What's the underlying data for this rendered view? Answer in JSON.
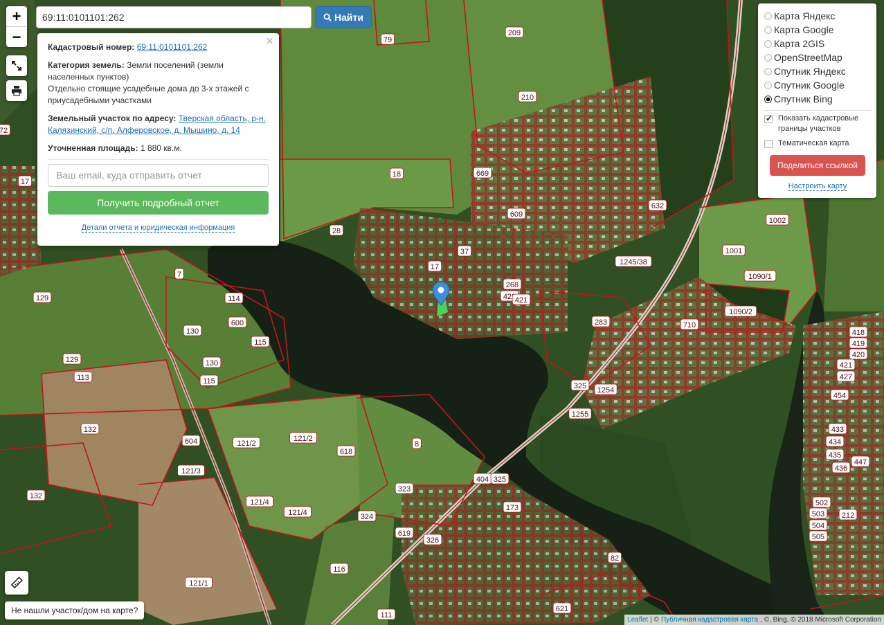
{
  "map": {
    "parcel_labels": [
      "209",
      "210",
      "79",
      "18",
      "28",
      "669",
      "609",
      "37",
      "17",
      "632",
      "1245/38",
      "268",
      "422",
      "421",
      "283",
      "1002",
      "1001",
      "1090/1",
      "1090/2",
      "710",
      "418",
      "419",
      "420",
      "421",
      "427",
      "454",
      "433",
      "434",
      "435",
      "436",
      "447",
      "502",
      "503",
      "504",
      "505",
      "212",
      "325",
      "1254",
      "1255",
      "404",
      "325",
      "7",
      "129",
      "114",
      "600",
      "130",
      "115",
      "130",
      "115",
      "129",
      "113",
      "132",
      "604",
      "121/3",
      "121/2",
      "121/2",
      "618",
      "8",
      "323",
      "324",
      "121/4",
      "121/4",
      "619",
      "326",
      "173",
      "116",
      "132",
      "121/1",
      "111",
      "621",
      "82",
      "72",
      "17"
    ],
    "icons": [
      "location-marker-icon"
    ]
  },
  "controls": {
    "zoom_in": "+",
    "zoom_out": "−"
  },
  "search": {
    "value": "69:11:0101101:262",
    "button_label": "Найти"
  },
  "popup": {
    "cadastral_label": "Кадастровый номер:",
    "cadastral_value": "69:11:0101101:262",
    "category_label": "Категория земель:",
    "category_value": "Земли поселений (земли населенных пунктов)",
    "use_value": "Отдельно стоящие усадебные дома до 3-х этажей с приусадебными участками",
    "address_label": "Земельный участок по адресу:",
    "address_value": "Тверская область, р-н. Калязинский, с/п. Алферовское, д. Мышино, д. 14",
    "area_label": "Уточненная площадь:",
    "area_value": "1 880 кв.м.",
    "email_placeholder": "Ваш email, куда отправить отчет",
    "report_button": "Получить подробный отчет",
    "details_link": "Детали отчета и юридическая информация"
  },
  "layers": {
    "options": [
      {
        "label": "Карта Яндекс",
        "selected": false
      },
      {
        "label": "Карта Google",
        "selected": false
      },
      {
        "label": "Карта 2GIS",
        "selected": false
      },
      {
        "label": "OpenStreetMap",
        "selected": false
      },
      {
        "label": "Спутник Яндекс",
        "selected": false
      },
      {
        "label": "Спутник Google",
        "selected": false
      },
      {
        "label": "Спутник Bing",
        "selected": true
      }
    ],
    "show_borders": "Показать кадастровые границы участков",
    "thematic": "Тематическая карта",
    "share_button": "Поделиться ссылкой",
    "tune_link": "Настроить карту"
  },
  "not_found": "Не нашли участок/дом на карте?",
  "attribution": {
    "leaflet": "Leaflet",
    "sep": "| ©",
    "pkk": "Публичная кадастровая карта",
    "rest": ", ©, Bing, © 2018 Microsoft Corporation"
  }
}
